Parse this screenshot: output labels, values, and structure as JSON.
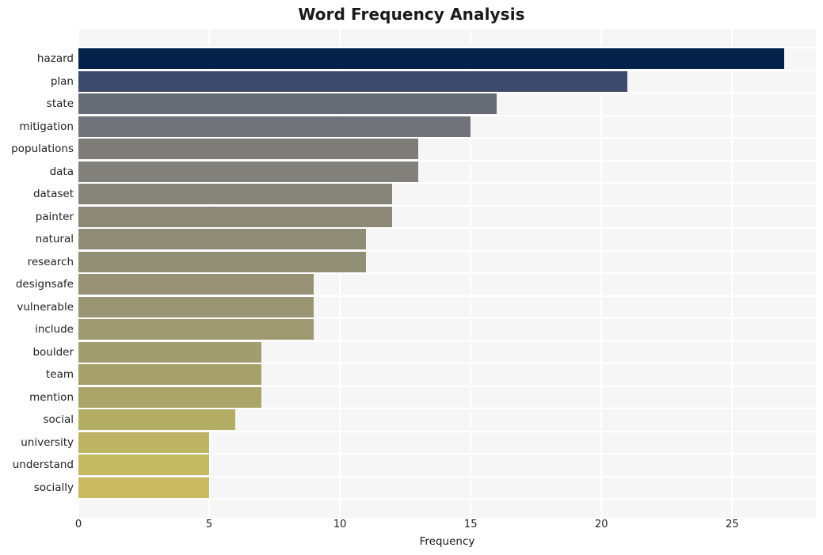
{
  "chart_data": {
    "type": "bar",
    "orientation": "horizontal",
    "title": "Word Frequency Analysis",
    "xlabel": "Frequency",
    "ylabel": "",
    "xlim": [
      0,
      28.2
    ],
    "xticks": [
      0,
      5,
      10,
      15,
      20,
      25
    ],
    "xtick_labels": [
      "0",
      "5",
      "10",
      "15",
      "20",
      "25"
    ],
    "grid": true,
    "grid_color": "#ffffff",
    "plot_background": "#f6f6f7",
    "figure_background": "#ffffff",
    "legend": null,
    "categories": [
      "hazard",
      "plan",
      "state",
      "mitigation",
      "populations",
      "data",
      "dataset",
      "painter",
      "natural",
      "research",
      "designsafe",
      "vulnerable",
      "include",
      "boulder",
      "team",
      "mention",
      "social",
      "university",
      "understand",
      "socially"
    ],
    "values": [
      27,
      21,
      16,
      15,
      13,
      13,
      12,
      12,
      11,
      11,
      9,
      9,
      9,
      7,
      7,
      7,
      6,
      5,
      5,
      5
    ],
    "bar_colors": [
      "#042249",
      "#3d4a6e",
      "#676b76",
      "#72737a",
      "#7d7c78",
      "#82807a",
      "#878579",
      "#8b8878",
      "#8f8c78",
      "#928f77",
      "#979275",
      "#9a9673",
      "#9d9971",
      "#a29d6e",
      "#a6a16b",
      "#aaa468",
      "#b3ac64",
      "#bcb363",
      "#c4ba62",
      "#cbba61"
    ],
    "series": [
      {
        "name": "Frequency",
        "points": [
          {
            "label": "hazard",
            "value": 27,
            "color": "#042249"
          },
          {
            "label": "plan",
            "value": 21,
            "color": "#3d4a6e"
          },
          {
            "label": "state",
            "value": 16,
            "color": "#676b76"
          },
          {
            "label": "mitigation",
            "value": 15,
            "color": "#72737a"
          },
          {
            "label": "populations",
            "value": 13,
            "color": "#7d7c78"
          },
          {
            "label": "data",
            "value": 13,
            "color": "#82807a"
          },
          {
            "label": "dataset",
            "value": 12,
            "color": "#878579"
          },
          {
            "label": "painter",
            "value": 12,
            "color": "#8b8878"
          },
          {
            "label": "natural",
            "value": 11,
            "color": "#8f8c78"
          },
          {
            "label": "research",
            "value": 11,
            "color": "#928f77"
          },
          {
            "label": "designsafe",
            "value": 9,
            "color": "#979275"
          },
          {
            "label": "vulnerable",
            "value": 9,
            "color": "#9a9673"
          },
          {
            "label": "include",
            "value": 9,
            "color": "#9d9971"
          },
          {
            "label": "boulder",
            "value": 7,
            "color": "#a29d6e"
          },
          {
            "label": "team",
            "value": 7,
            "color": "#a6a16b"
          },
          {
            "label": "mention",
            "value": 7,
            "color": "#aaa468"
          },
          {
            "label": "social",
            "value": 6,
            "color": "#b3ac64"
          },
          {
            "label": "university",
            "value": 5,
            "color": "#bcb363"
          },
          {
            "label": "understand",
            "value": 5,
            "color": "#c4ba62"
          },
          {
            "label": "socially",
            "value": 5,
            "color": "#cbba61"
          }
        ]
      }
    ]
  }
}
